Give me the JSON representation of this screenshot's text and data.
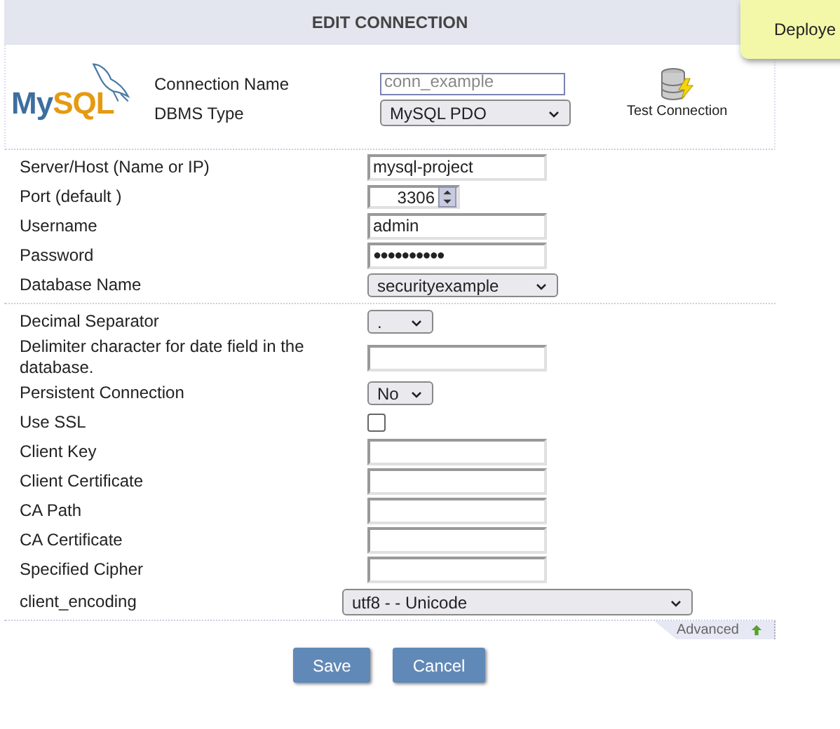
{
  "title": "EDIT CONNECTION",
  "toast": "Deploye",
  "logo": {
    "main": "My",
    "accent": "SQL"
  },
  "top_fields": [
    {
      "label": "Connection Name",
      "kind": "text",
      "value": "conn_example",
      "disabled": true
    },
    {
      "label": "DBMS Type",
      "kind": "select",
      "value": "MySQL PDO"
    }
  ],
  "test_connection": "Test Connection",
  "sections": [
    [
      {
        "label": "Server/Host (Name or IP)",
        "kind": "text",
        "value": "mysql-project"
      },
      {
        "label": "Port (default )",
        "kind": "number",
        "value": "3306"
      },
      {
        "label": "Username",
        "kind": "text",
        "value": "admin"
      },
      {
        "label": "Password",
        "kind": "password",
        "value": "●●●●●●●●●●"
      },
      {
        "label": "Database Name",
        "kind": "select",
        "value": "securityexample"
      }
    ],
    [
      {
        "label": "Decimal Separator",
        "kind": "small-select",
        "value": "."
      },
      {
        "label": "Delimiter character for date field in the database.",
        "kind": "text"
      },
      {
        "label": "Persistent Connection",
        "kind": "small-select",
        "value": "No"
      },
      {
        "label": "Use SSL",
        "kind": "checkbox",
        "checked": false
      },
      {
        "label": "Client Key",
        "kind": "text"
      },
      {
        "label": "Client Certificate",
        "kind": "text"
      },
      {
        "label": "CA Path",
        "kind": "text"
      },
      {
        "label": "CA Certificate",
        "kind": "text"
      },
      {
        "label": "Specified Cipher",
        "kind": "text"
      },
      {
        "label": "client_encoding",
        "kind": "wide-select",
        "value": "utf8 - - Unicode"
      }
    ]
  ],
  "advanced": "Advanced",
  "buttons": [
    "Save",
    "Cancel"
  ]
}
